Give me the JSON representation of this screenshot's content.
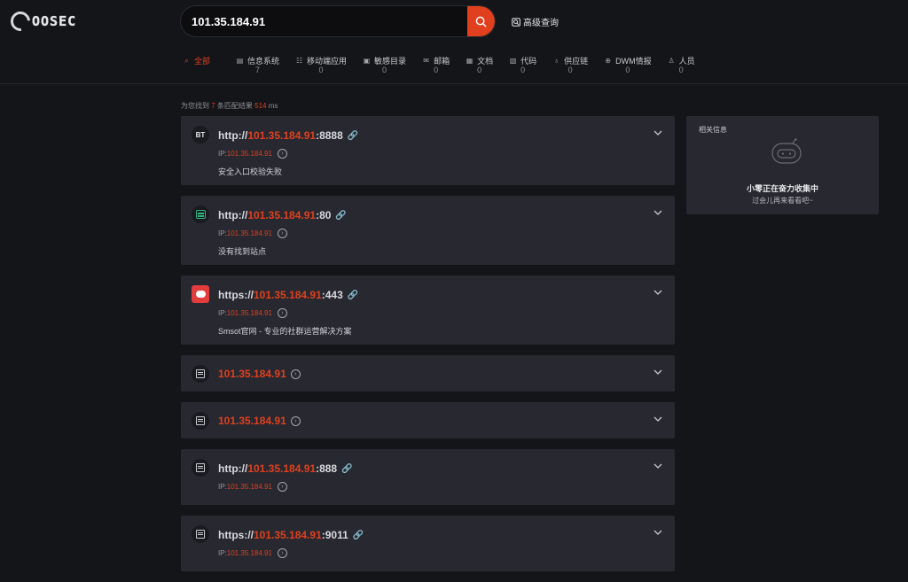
{
  "brand": {
    "logo_text": "OOSEC"
  },
  "search": {
    "value": "101.35.184.91",
    "placeholder": ""
  },
  "advanced_label": "高级查询",
  "categories": [
    {
      "label": "全部",
      "count": "",
      "icon": "search-icon",
      "active": true
    },
    {
      "label": "信息系统",
      "count": "7",
      "icon": "list-icon"
    },
    {
      "label": "移动端应用",
      "count": "0",
      "icon": "bot-icon"
    },
    {
      "label": "敏感目录",
      "count": "0",
      "icon": "doc-icon"
    },
    {
      "label": "邮箱",
      "count": "0",
      "icon": "mail-icon"
    },
    {
      "label": "文档",
      "count": "0",
      "icon": "file-icon"
    },
    {
      "label": "代码",
      "count": "0",
      "icon": "code-icon"
    },
    {
      "label": "供应链",
      "count": "0",
      "icon": "bell-icon"
    },
    {
      "label": "DWM情报",
      "count": "0",
      "icon": "globe-icon"
    },
    {
      "label": "人员",
      "count": "0",
      "icon": "person-icon"
    }
  ],
  "stats": {
    "prefix": "为您找到",
    "count": "7",
    "middle": "条匹配结果",
    "time": "514",
    "unit": "ms"
  },
  "results": [
    {
      "icon": "bt-icon",
      "icon_text": "BT",
      "scheme": "http://",
      "host": "101.35.184.91",
      "port": ":8888",
      "ip_label": "IP:",
      "ip": "101.35.184.91",
      "title": "安全入口校验失败"
    },
    {
      "icon": "site-icon",
      "scheme": "http://",
      "host": "101.35.184.91",
      "port": ":80",
      "ip_label": "IP:",
      "ip": "101.35.184.91",
      "title": "没有找到站点"
    },
    {
      "icon": "smsot-icon",
      "scheme": "https://",
      "host": "101.35.184.91",
      "port": ":443",
      "ip_label": "IP:",
      "ip": "101.35.184.91",
      "title": "Smsot官网 - 专业的社群运营解决方案"
    },
    {
      "icon": "server-icon",
      "host": "101.35.184.91"
    },
    {
      "icon": "server-icon",
      "host": "101.35.184.91"
    },
    {
      "icon": "server-icon",
      "scheme": "http://",
      "host": "101.35.184.91",
      "port": ":888",
      "ip_label": "IP:",
      "ip": "101.35.184.91"
    },
    {
      "icon": "server-icon",
      "scheme": "https://",
      "host": "101.35.184.91",
      "port": ":9011",
      "ip_label": "IP:",
      "ip": "101.35.184.91"
    }
  ],
  "side": {
    "header": "相关信息",
    "msg1": "小零正在奋力收集中",
    "msg2": "过会儿再来看看吧~"
  },
  "colors": {
    "accent": "#e0401e",
    "card": "#272830",
    "bg": "#141519"
  }
}
